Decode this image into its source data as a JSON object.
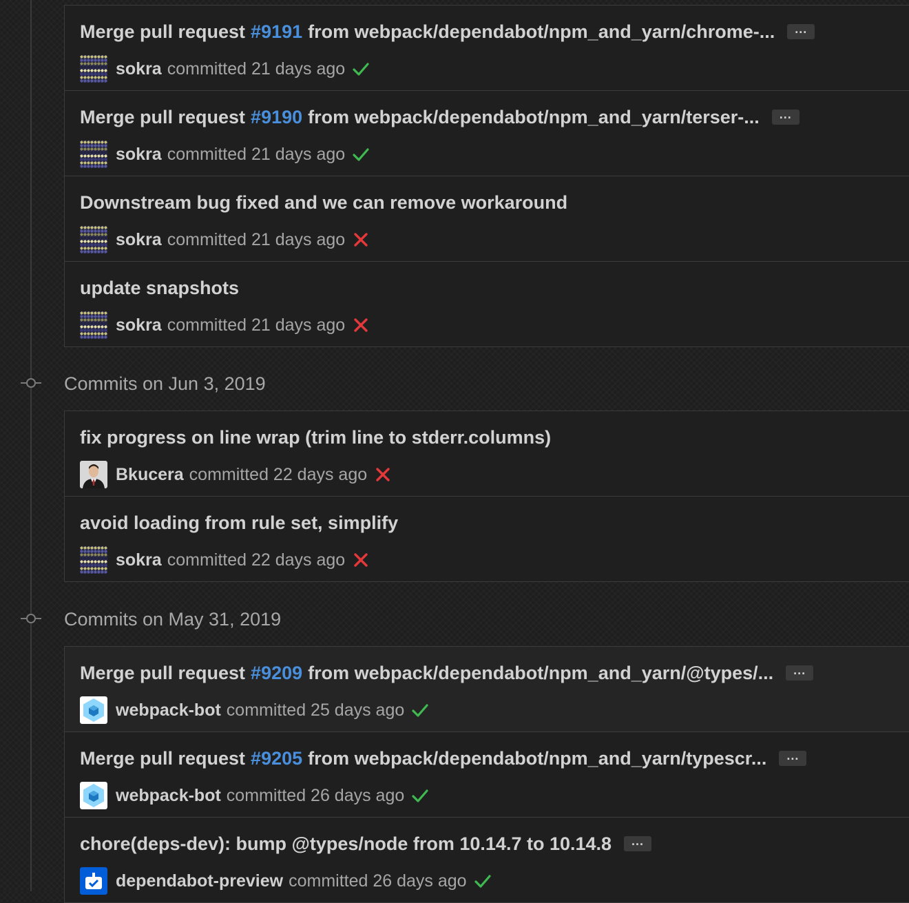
{
  "groups": [
    {
      "title": "",
      "commits": [
        {
          "message": "Merge pull request",
          "pr": "#9191",
          "message_rest": "from webpack/dependabot/npm_and_yarn/chrome-...",
          "has_ellipsis": true,
          "author": "sokra",
          "committed": "committed 21 days ago",
          "status": "success",
          "avatar": "sokra"
        },
        {
          "message": "Merge pull request",
          "pr": "#9190",
          "message_rest": "from webpack/dependabot/npm_and_yarn/terser-...",
          "has_ellipsis": true,
          "author": "sokra",
          "committed": "committed 21 days ago",
          "status": "success",
          "avatar": "sokra"
        },
        {
          "message": "Downstream bug fixed and we can remove workaround",
          "pr": "",
          "message_rest": "",
          "has_ellipsis": false,
          "author": "sokra",
          "committed": "committed 21 days ago",
          "status": "failure",
          "avatar": "sokra"
        },
        {
          "message": "update snapshots",
          "pr": "",
          "message_rest": "",
          "has_ellipsis": false,
          "author": "sokra",
          "committed": "committed 21 days ago",
          "status": "failure",
          "avatar": "sokra"
        }
      ]
    },
    {
      "title": "Commits on Jun 3, 2019",
      "commits": [
        {
          "message": "fix progress on line wrap (trim line to stderr.columns)",
          "pr": "",
          "message_rest": "",
          "has_ellipsis": false,
          "author": "Bkucera",
          "committed": "committed 22 days ago",
          "status": "failure",
          "avatar": "bkucera"
        },
        {
          "message": "avoid loading from rule set, simplify",
          "pr": "",
          "message_rest": "",
          "has_ellipsis": false,
          "author": "sokra",
          "committed": "committed 22 days ago",
          "status": "failure",
          "avatar": "sokra"
        }
      ]
    },
    {
      "title": "Commits on May 31, 2019",
      "commits": [
        {
          "message": "Merge pull request",
          "pr": "#9209",
          "message_rest": "from webpack/dependabot/npm_and_yarn/@types/...",
          "has_ellipsis": true,
          "author": "webpack-bot",
          "committed": "committed 25 days ago",
          "status": "success",
          "avatar": "webpack-bot"
        },
        {
          "message": "Merge pull request",
          "pr": "#9205",
          "message_rest": "from webpack/dependabot/npm_and_yarn/typescr...",
          "has_ellipsis": true,
          "author": "webpack-bot",
          "committed": "committed 26 days ago",
          "status": "success",
          "avatar": "webpack-bot"
        },
        {
          "message": "chore(deps-dev): bump @types/node from 10.14.7 to 10.14.8",
          "pr": "",
          "message_rest": "",
          "has_ellipsis": true,
          "author": "dependabot-preview",
          "committed": "committed 26 days ago",
          "status": "success",
          "avatar": "dependabot"
        }
      ]
    }
  ],
  "ellipsis_label": "...",
  "colors": {
    "link": "#4a8fdc",
    "success": "#3fb950",
    "failure": "#e5383b"
  }
}
